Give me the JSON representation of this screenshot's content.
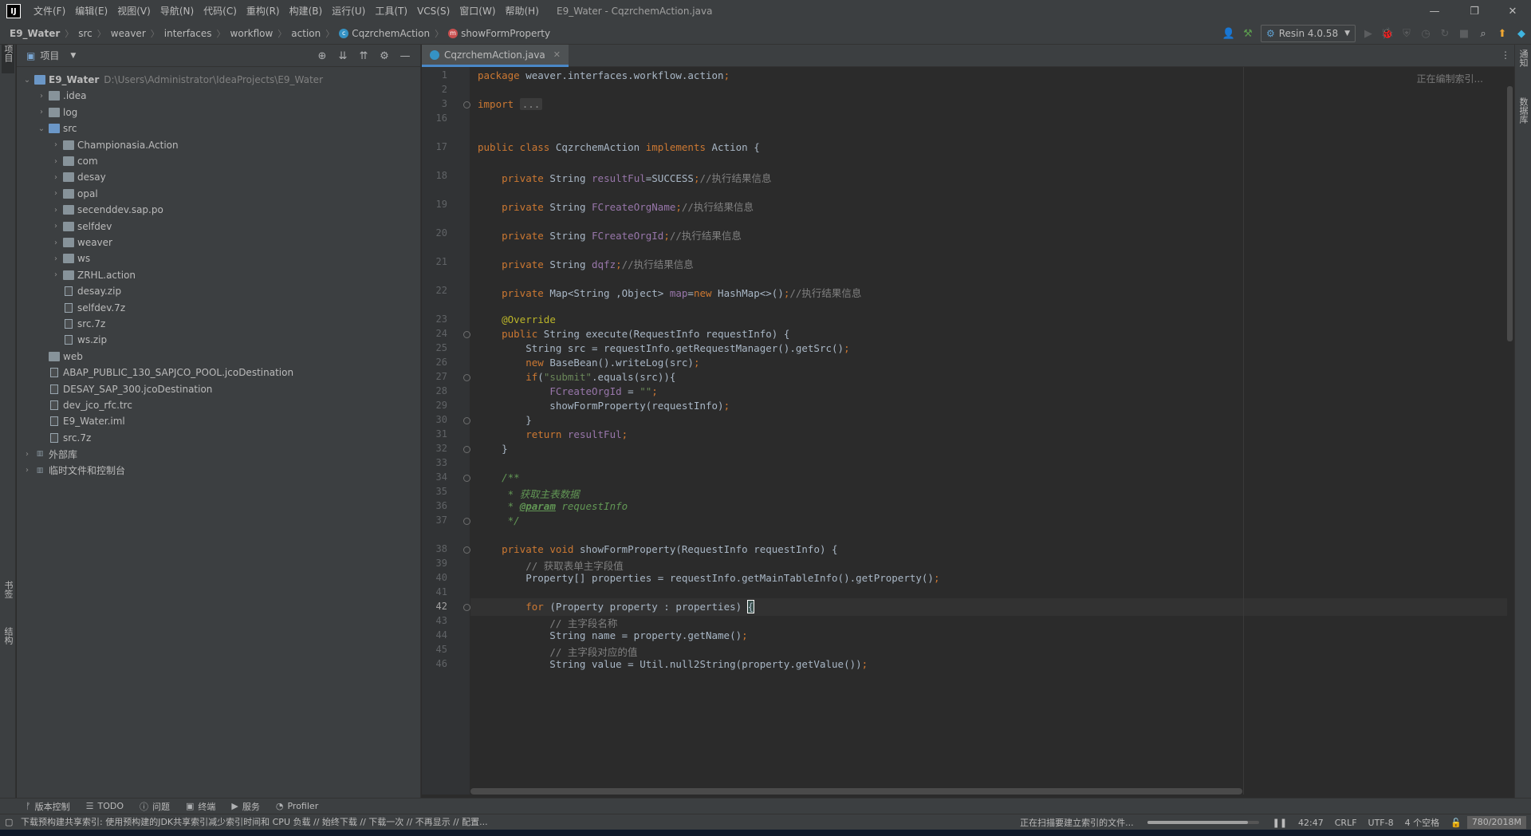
{
  "app": {
    "logo": "IJ",
    "window_title": "E9_Water - CqzrchemAction.java",
    "menu": [
      "文件(F)",
      "编辑(E)",
      "视图(V)",
      "导航(N)",
      "代码(C)",
      "重构(R)",
      "构建(B)",
      "运行(U)",
      "工具(T)",
      "VCS(S)",
      "窗口(W)",
      "帮助(H)"
    ]
  },
  "breadcrumb": [
    "E9_Water",
    "src",
    "weaver",
    "interfaces",
    "workflow",
    "action",
    "CqzrchemAction",
    "showFormProperty"
  ],
  "toolbar": {
    "run_config": "Resin 4.0.58"
  },
  "left_strip": {
    "project_tab": "项目",
    "bookmarks_tab": "书签",
    "structure_tab": "结构"
  },
  "right_strip": {
    "notifications_tab": "通知",
    "database_tab": "数据库"
  },
  "project_panel": {
    "title": "项目",
    "tree": [
      {
        "label": "E9_Water",
        "path": "D:\\Users\\Administrator\\IdeaProjects\\E9_Water",
        "depth": 0,
        "arrow": "v",
        "kind": "module",
        "bold": true
      },
      {
        "label": ".idea",
        "depth": 1,
        "arrow": ">",
        "kind": "folder"
      },
      {
        "label": "log",
        "depth": 1,
        "arrow": ">",
        "kind": "folder"
      },
      {
        "label": "src",
        "depth": 1,
        "arrow": "v",
        "kind": "folder-blue"
      },
      {
        "label": "Championasia.Action",
        "depth": 2,
        "arrow": ">",
        "kind": "folder"
      },
      {
        "label": "com",
        "depth": 2,
        "arrow": ">",
        "kind": "folder"
      },
      {
        "label": "desay",
        "depth": 2,
        "arrow": ">",
        "kind": "folder"
      },
      {
        "label": "opal",
        "depth": 2,
        "arrow": ">",
        "kind": "folder"
      },
      {
        "label": "secenddev.sap.po",
        "depth": 2,
        "arrow": ">",
        "kind": "folder"
      },
      {
        "label": "selfdev",
        "depth": 2,
        "arrow": ">",
        "kind": "folder"
      },
      {
        "label": "weaver",
        "depth": 2,
        "arrow": ">",
        "kind": "folder"
      },
      {
        "label": "ws",
        "depth": 2,
        "arrow": ">",
        "kind": "folder"
      },
      {
        "label": "ZRHL.action",
        "depth": 2,
        "arrow": ">",
        "kind": "folder"
      },
      {
        "label": "desay.zip",
        "depth": 2,
        "arrow": "",
        "kind": "file"
      },
      {
        "label": "selfdev.7z",
        "depth": 2,
        "arrow": "",
        "kind": "file"
      },
      {
        "label": "src.7z",
        "depth": 2,
        "arrow": "",
        "kind": "file"
      },
      {
        "label": "ws.zip",
        "depth": 2,
        "arrow": "",
        "kind": "file"
      },
      {
        "label": "web",
        "depth": 1,
        "arrow": "",
        "kind": "folder"
      },
      {
        "label": "ABAP_PUBLIC_130_SAPJCO_POOL.jcoDestination",
        "depth": 1,
        "arrow": "",
        "kind": "file"
      },
      {
        "label": "DESAY_SAP_300.jcoDestination",
        "depth": 1,
        "arrow": "",
        "kind": "file"
      },
      {
        "label": "dev_jco_rfc.trc",
        "depth": 1,
        "arrow": "",
        "kind": "file"
      },
      {
        "label": "E9_Water.iml",
        "depth": 1,
        "arrow": "",
        "kind": "file"
      },
      {
        "label": "src.7z",
        "depth": 1,
        "arrow": "",
        "kind": "file"
      },
      {
        "label": "外部库",
        "depth": 0,
        "arrow": ">",
        "kind": "lib"
      },
      {
        "label": "临时文件和控制台",
        "depth": 0,
        "arrow": ">",
        "kind": "lib"
      }
    ]
  },
  "editor": {
    "tab_label": "CqzrchemAction.java",
    "indexing": "正在编制索引...",
    "current_line": "42",
    "lines": [
      {
        "n": "1",
        "html": "<span class=\"kw\">package</span> weaver.interfaces.workflow.action<span class=\"kw\">;</span>"
      },
      {
        "n": "2",
        "html": ""
      },
      {
        "n": "3",
        "html": "<span class=\"kw\">import</span> <span class=\"fold-block\">...</span>"
      },
      {
        "n": "16",
        "html": ""
      },
      {
        "n": "",
        "html": ""
      },
      {
        "n": "17",
        "html": "<span class=\"kw\">public class</span> CqzrchemAction <span class=\"kw\">implements</span> Action {"
      },
      {
        "n": "",
        "html": ""
      },
      {
        "n": "18",
        "html": "    <span class=\"kw\">private</span> String <span class=\"fld\">resultFul</span>=SUCCESS<span class=\"kw\">;</span><span class=\"cm\">//执行结果信息</span>"
      },
      {
        "n": "",
        "html": ""
      },
      {
        "n": "19",
        "html": "    <span class=\"kw\">private</span> String <span class=\"fld\">FCreateOrgName</span><span class=\"kw\">;</span><span class=\"cm\">//执行结果信息</span>"
      },
      {
        "n": "",
        "html": ""
      },
      {
        "n": "20",
        "html": "    <span class=\"kw\">private</span> String <span class=\"fld\">FCreateOrgId</span><span class=\"kw\">;</span><span class=\"cm\">//执行结果信息</span>"
      },
      {
        "n": "",
        "html": ""
      },
      {
        "n": "21",
        "html": "    <span class=\"kw\">private</span> String <span class=\"fld\">dqfz</span><span class=\"kw\">;</span><span class=\"cm\">//执行结果信息</span>"
      },
      {
        "n": "",
        "html": ""
      },
      {
        "n": "22",
        "html": "    <span class=\"kw\">private</span> Map&lt;String ,Object&gt; <span class=\"fld\">map</span>=<span class=\"kw\">new</span> HashMap&lt;&gt;()<span class=\"kw\">;</span><span class=\"cm\">//执行结果信息</span>"
      },
      {
        "n": "",
        "html": ""
      },
      {
        "n": "23",
        "html": "    <span class=\"ann\">@Override</span>"
      },
      {
        "n": "24",
        "html": "    <span class=\"kw\">public</span> String execute(RequestInfo requestInfo) {"
      },
      {
        "n": "25",
        "html": "        String src = requestInfo.getRequestManager().getSrc()<span class=\"kw\">;</span>"
      },
      {
        "n": "26",
        "html": "        <span class=\"kw\">new</span> BaseBean().writeLog(src)<span class=\"kw\">;</span>"
      },
      {
        "n": "27",
        "html": "        <span class=\"kw\">if</span>(<span class=\"str\">\"submit\"</span>.equals(src)){"
      },
      {
        "n": "28",
        "html": "            <span class=\"fld\">FCreateOrgId</span> = <span class=\"str\">\"\"</span><span class=\"kw\">;</span>"
      },
      {
        "n": "29",
        "html": "            showFormProperty(requestInfo)<span class=\"kw\">;</span>"
      },
      {
        "n": "30",
        "html": "        }"
      },
      {
        "n": "31",
        "html": "        <span class=\"kw\">return</span> <span class=\"fld\">resultFul</span><span class=\"kw\">;</span>"
      },
      {
        "n": "32",
        "html": "    }"
      },
      {
        "n": "33",
        "html": ""
      },
      {
        "n": "34",
        "html": "    <span class=\"doc\">/**</span>"
      },
      {
        "n": "35",
        "html": "<span class=\"doc\">     * 获取主表数据</span>"
      },
      {
        "n": "36",
        "html": "<span class=\"doc\">     * <b><u>@param</u></b> requestInfo</span>"
      },
      {
        "n": "37",
        "html": "<span class=\"doc\">     */</span>"
      },
      {
        "n": "",
        "html": ""
      },
      {
        "n": "38",
        "html": "    <span class=\"kw\">private void</span> showFormProperty(RequestInfo requestInfo) {"
      },
      {
        "n": "39",
        "html": "        <span class=\"cm\">// 获取表单主字段值</span>"
      },
      {
        "n": "40",
        "html": "        Property[] properties = requestInfo.getMainTableInfo().getProperty()<span class=\"kw\">;</span>"
      },
      {
        "n": "41",
        "html": ""
      },
      {
        "n": "42",
        "html": "        <span class=\"kw\">for</span> (Property property : properties) <span class=\"match\">{</span>"
      },
      {
        "n": "43",
        "html": "            <span class=\"cm\">// 主字段名称</span>"
      },
      {
        "n": "44",
        "html": "            String name = property.getName()<span class=\"kw\">;</span>"
      },
      {
        "n": "45",
        "html": "            <span class=\"cm\">// 主字段对应的值</span>"
      },
      {
        "n": "46",
        "html": "            String value = Util.null2String(property.getValue())<span class=\"kw\">;</span>"
      }
    ]
  },
  "bottom_tools": [
    {
      "icon": "ᚠ",
      "label": "版本控制"
    },
    {
      "icon": "☰",
      "label": "TODO"
    },
    {
      "icon": "ⓘ",
      "label": "问题"
    },
    {
      "icon": "▣",
      "label": "终端"
    },
    {
      "icon": "▶",
      "label": "服务"
    },
    {
      "icon": "◔",
      "label": "Profiler"
    }
  ],
  "status": {
    "message": "下载预构建共享索引: 使用预构建的JDK共享索引减少索引时间和 CPU 负载 // 始终下载 // 下载一次 // 不再显示 // 配置...",
    "scanning": "正在扫描要建立索引的文件...",
    "progress": 0.9,
    "position": "42:47",
    "line_sep": "CRLF",
    "encoding": "UTF-8",
    "indent": "4 个空格",
    "memory": "780/2018M"
  }
}
